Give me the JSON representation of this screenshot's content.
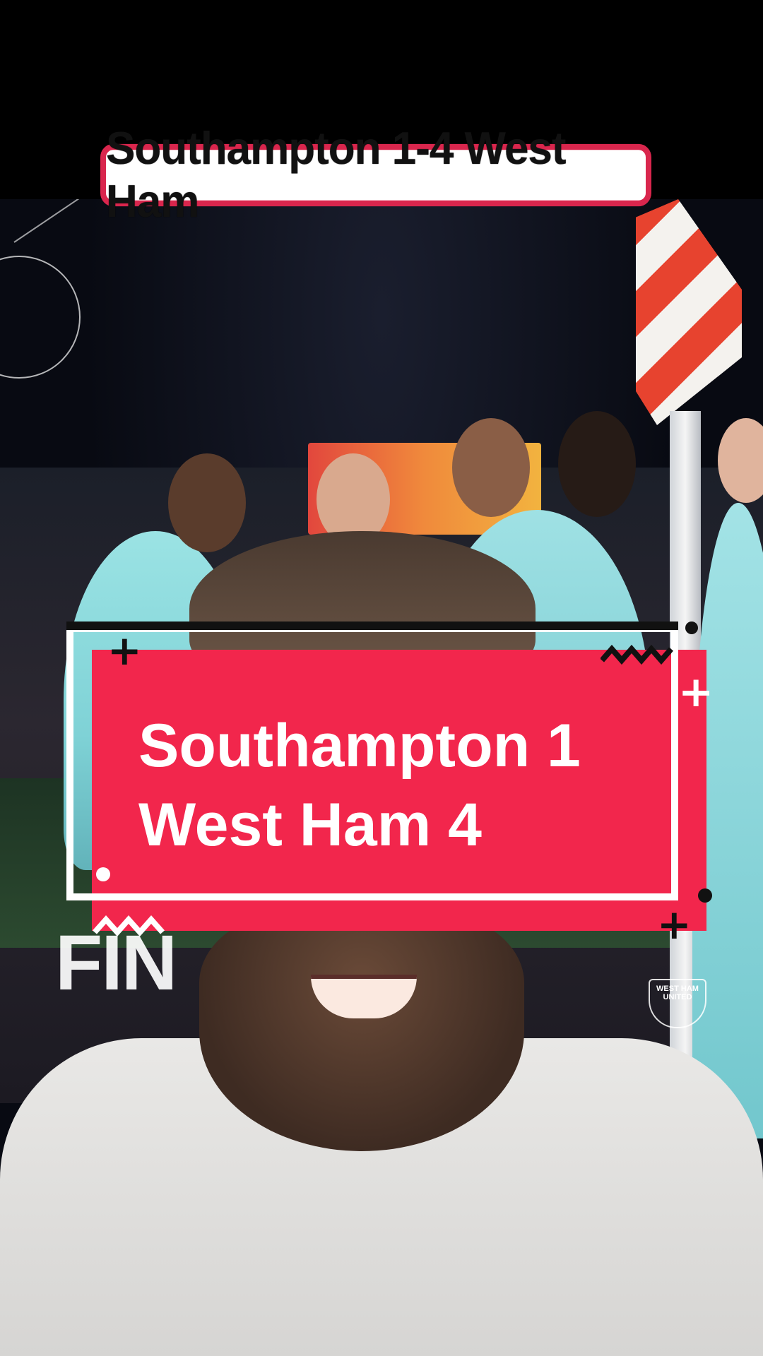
{
  "video": {
    "title": "Southampton 1-4 West Ham"
  },
  "score_card": {
    "home_line": "Southampton 1",
    "away_line": "West Ham 4"
  },
  "background": {
    "side_text": "FIN",
    "crest_text": "WEST HAM UNITED"
  },
  "colors": {
    "accent": "#f2264c",
    "title_border": "#d9264d",
    "frame": "#ffffff",
    "kit": "#8fd8dc"
  },
  "icons": {
    "plus": "+"
  }
}
